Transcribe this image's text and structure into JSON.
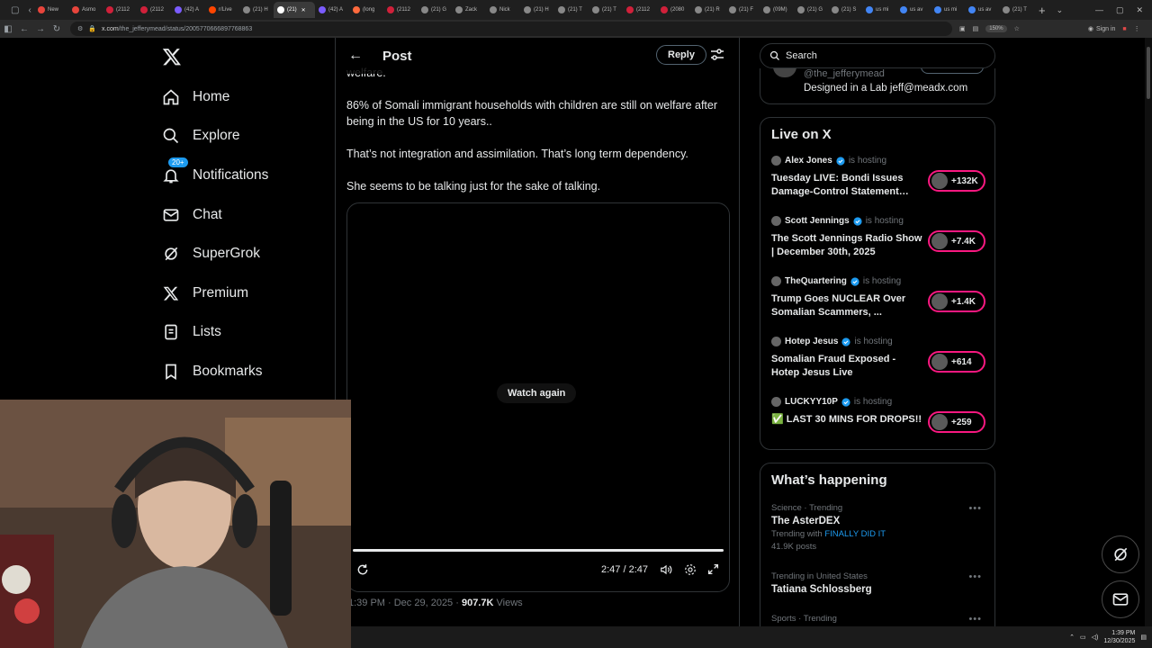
{
  "browser": {
    "tabs": [
      {
        "label": "New",
        "color": "#e8453c"
      },
      {
        "label": "Asmo",
        "color": "#e8453c"
      },
      {
        "label": "(2112",
        "color": "#d0203a"
      },
      {
        "label": "(2112",
        "color": "#d0203a"
      },
      {
        "label": "(42) A",
        "color": "#7b5cff"
      },
      {
        "label": "r/Live",
        "color": "#ff4500"
      },
      {
        "label": "(21) H",
        "color": "#888888"
      },
      {
        "label": "(21)",
        "color": "#ffffff"
      },
      {
        "label": "(42) A",
        "color": "#7b5cff"
      },
      {
        "label": "(long",
        "color": "#ff6a3d"
      },
      {
        "label": "(2112",
        "color": "#d0203a"
      },
      {
        "label": "(21) G",
        "color": "#888888"
      },
      {
        "label": "Zack",
        "color": "#888888"
      },
      {
        "label": "Nick",
        "color": "#888888"
      },
      {
        "label": "(21) H",
        "color": "#888888"
      },
      {
        "label": "(21) T",
        "color": "#888888"
      },
      {
        "label": "(21) T",
        "color": "#888888"
      },
      {
        "label": "(2112",
        "color": "#d0203a"
      },
      {
        "label": "(2080",
        "color": "#d0203a"
      },
      {
        "label": "(21) R",
        "color": "#888888"
      },
      {
        "label": "(21) F",
        "color": "#888888"
      },
      {
        "label": "(09M)",
        "color": "#888888"
      },
      {
        "label": "(21) G",
        "color": "#888888"
      },
      {
        "label": "(21) S",
        "color": "#888888"
      },
      {
        "label": "us mi",
        "color": "#4285f4"
      },
      {
        "label": "us av",
        "color": "#4285f4"
      },
      {
        "label": "us mi",
        "color": "#4285f4"
      },
      {
        "label": "us av",
        "color": "#4285f4"
      },
      {
        "label": "(21) T",
        "color": "#888888"
      }
    ],
    "url_host": "x.com",
    "url_path": "/the_jefferymead/status/2005770666897768863",
    "zoom": "150%",
    "signin_label": "Sign in"
  },
  "nav": {
    "items": [
      {
        "label": "Home",
        "icon": "home-icon"
      },
      {
        "label": "Explore",
        "icon": "search-icon"
      },
      {
        "label": "Notifications",
        "icon": "bell-icon",
        "badge": "20+"
      },
      {
        "label": "Chat",
        "icon": "mail-icon"
      },
      {
        "label": "SuperGrok",
        "icon": "grok-icon"
      },
      {
        "label": "Premium",
        "icon": "x-icon"
      },
      {
        "label": "Lists",
        "icon": "list-icon"
      },
      {
        "label": "Bookmarks",
        "icon": "bookmark-icon"
      }
    ]
  },
  "post": {
    "header_title": "Post",
    "reply_label": "Reply",
    "cut_text": "welfare.",
    "paragraphs": [
      "86% of Somali immigrant households with children are still on welfare after being in the US for 10 years..",
      "That’s not integration and assimilation. That’s long term dependency.",
      "She seems to be talking just for the sake of talking."
    ],
    "video": {
      "watch_again": "Watch again",
      "time": "2:47 / 2:47",
      "progress": 1.0
    },
    "meta_time": "1:39 PM · Dec 29, 2025 · ",
    "views_count": "907.7K",
    "views_label": " Views"
  },
  "right": {
    "search_placeholder": "Search",
    "profile_handle": "@the_jefferymead",
    "profile_bio": "Designed in a Lab jeff@meadx.com",
    "live_title": "Live on X",
    "hosting_label": "is hosting",
    "live": [
      {
        "host": "Alex Jones",
        "title": "Tuesday LIVE: Bondi Issues Damage-Control Statement…",
        "count": "+132K"
      },
      {
        "host": "Scott Jennings",
        "title": "The Scott Jennings Radio Show | December 30th, 2025",
        "count": "+7.4K"
      },
      {
        "host": "TheQuartering",
        "title": "Trump Goes NUCLEAR Over Somalian Scammers, ...",
        "count": "+1.4K"
      },
      {
        "host": "Hotep Jesus",
        "title": "Somalian Fraud Exposed - Hotep Jesus Live",
        "count": "+614"
      },
      {
        "host": "LUCKYY10P",
        "title": "✅ LAST 30 MINS FOR DROPS!!",
        "count": "+259"
      }
    ],
    "happening_title": "What’s happening",
    "trends": [
      {
        "category": "Science · Trending",
        "name": "The AsterDEX",
        "with_prefix": "Trending with ",
        "with_link": "FINALLY DID IT",
        "posts": "41.9K posts"
      },
      {
        "category": "Trending in United States",
        "name": "Tatiana Schlossberg"
      },
      {
        "category": "Sports · Trending"
      }
    ]
  },
  "taskbar": {
    "time": "1:39 PM",
    "date": "12/30/2025"
  }
}
